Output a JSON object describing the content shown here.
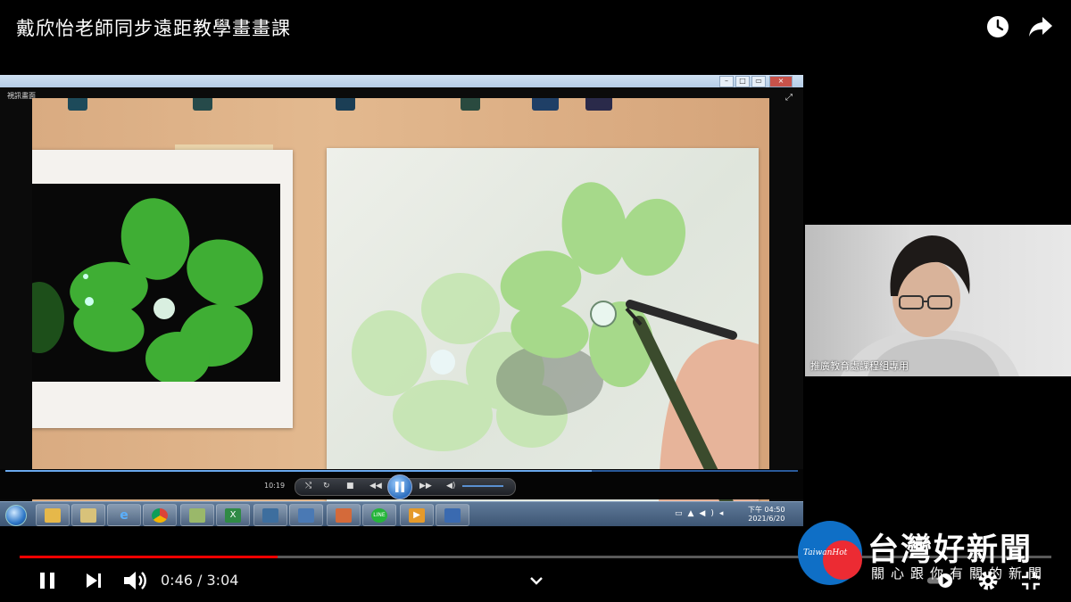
{
  "video_title": "戴欣怡老師同步遠距教學畫畫課",
  "top_icons": {
    "watch_later": "clock-icon",
    "share": "share-arrow-icon"
  },
  "shared_window": {
    "window_label": "視訊畫面",
    "player": {
      "time": "10:19",
      "progress_fraction": 0.74
    },
    "taskbar": {
      "apps": [
        "folder",
        "files",
        "ie",
        "chrome",
        "photos",
        "excel",
        "network",
        "outlook",
        "media",
        "line",
        "player",
        "window"
      ],
      "clock_period": "下午",
      "clock_time": "04:50",
      "clock_date": "2021/6/20"
    }
  },
  "webcam": {
    "label": "推廣教育處課程組專用"
  },
  "player": {
    "current_time": "0:46",
    "separator": " / ",
    "duration": "3:04",
    "progress_fraction": 0.25,
    "progress_color": "#ff0000"
  },
  "watermark": {
    "logo_text": "TaiwanHot",
    "title": "台灣好新聞",
    "subtitle": "關心跟你有關的新聞"
  }
}
